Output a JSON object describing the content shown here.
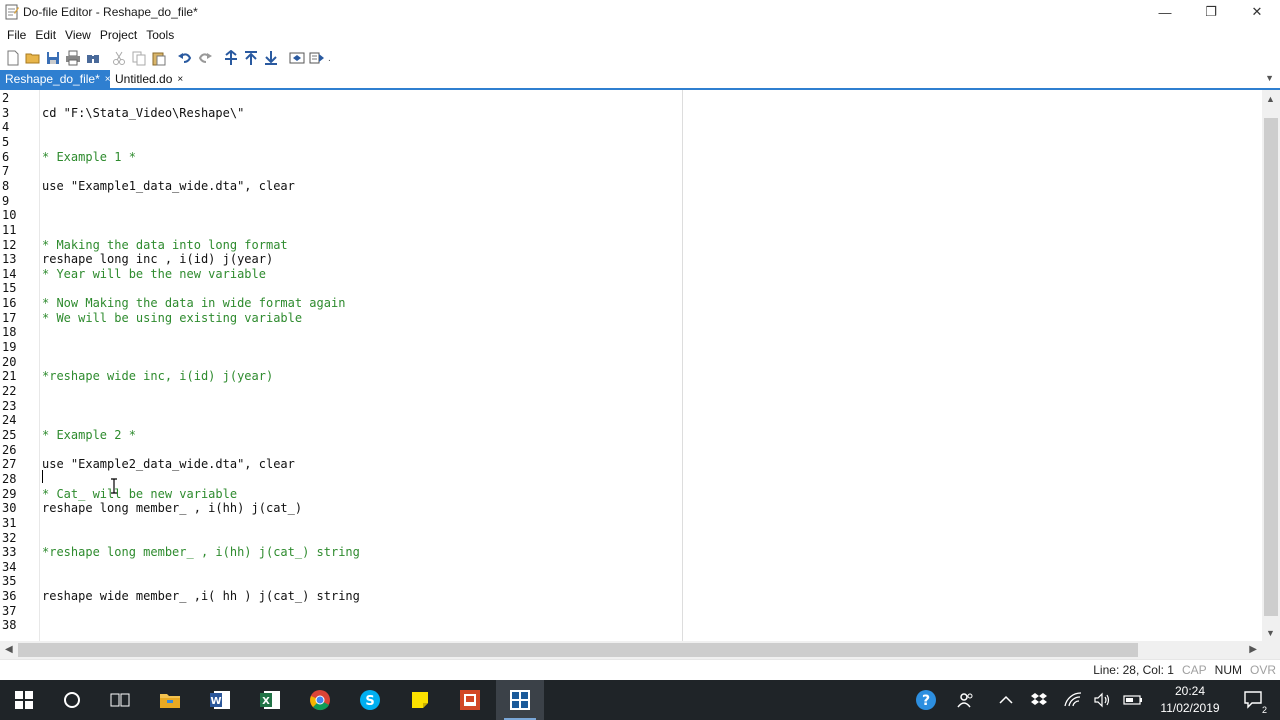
{
  "window": {
    "title": "Do-file Editor - Reshape_do_file*",
    "controls": {
      "minimize": "—",
      "maximize": "❐",
      "close": "✕"
    }
  },
  "menu": [
    "File",
    "Edit",
    "View",
    "Project",
    "Tools"
  ],
  "toolbar_icons": [
    "new-file-icon",
    "open-folder-icon",
    "save-icon",
    "print-icon",
    "find-icon",
    "cut-icon",
    "copy-icon",
    "paste-icon",
    "undo-icon",
    "redo-icon",
    "indent-icon",
    "move-up-icon",
    "move-down-icon",
    "show-hide-icon",
    "execute-icon"
  ],
  "tabs": [
    {
      "label": "Reshape_do_file*",
      "close": "×",
      "active": true
    },
    {
      "label": "Untitled.do",
      "close": "×",
      "active": false
    }
  ],
  "editor": {
    "lines": [
      {
        "n": "2",
        "text": "",
        "type": "code"
      },
      {
        "n": "3",
        "text": "cd \"F:\\Stata_Video\\Reshape\\\"",
        "type": "code"
      },
      {
        "n": "4",
        "text": "",
        "type": "code"
      },
      {
        "n": "5",
        "text": "",
        "type": "code"
      },
      {
        "n": "6",
        "text": "* Example 1 *",
        "type": "comment"
      },
      {
        "n": "7",
        "text": "",
        "type": "code"
      },
      {
        "n": "8",
        "text": "use \"Example1_data_wide.dta\", clear",
        "type": "code"
      },
      {
        "n": "9",
        "text": "",
        "type": "code"
      },
      {
        "n": "10",
        "text": "",
        "type": "code"
      },
      {
        "n": "11",
        "text": "",
        "type": "code"
      },
      {
        "n": "12",
        "text": "* Making the data into long format",
        "type": "comment"
      },
      {
        "n": "13",
        "text": "reshape long inc , i(id) j(year)",
        "type": "code"
      },
      {
        "n": "14",
        "text": "* Year will be the new variable",
        "type": "comment"
      },
      {
        "n": "15",
        "text": "",
        "type": "code"
      },
      {
        "n": "16",
        "text": "* Now Making the data in wide format again",
        "type": "comment"
      },
      {
        "n": "17",
        "text": "* We will be using existing variable",
        "type": "comment"
      },
      {
        "n": "18",
        "text": "",
        "type": "code"
      },
      {
        "n": "19",
        "text": "",
        "type": "code"
      },
      {
        "n": "20",
        "text": "",
        "type": "code"
      },
      {
        "n": "21",
        "text": "*reshape wide inc, i(id) j(year)",
        "type": "comment"
      },
      {
        "n": "22",
        "text": "",
        "type": "code"
      },
      {
        "n": "23",
        "text": "",
        "type": "code"
      },
      {
        "n": "24",
        "text": "",
        "type": "code"
      },
      {
        "n": "25",
        "text": "* Example 2 *",
        "type": "comment"
      },
      {
        "n": "26",
        "text": "",
        "type": "code"
      },
      {
        "n": "27",
        "text": "use \"Example2_data_wide.dta\", clear",
        "type": "code"
      },
      {
        "n": "28",
        "text": "",
        "type": "code"
      },
      {
        "n": "29",
        "text": "* Cat_ will be new variable",
        "type": "comment"
      },
      {
        "n": "30",
        "text": "reshape long member_ , i(hh) j(cat_)",
        "type": "code"
      },
      {
        "n": "31",
        "text": "",
        "type": "code"
      },
      {
        "n": "32",
        "text": "",
        "type": "code"
      },
      {
        "n": "33",
        "text": "*reshape long member_ , i(hh) j(cat_) string",
        "type": "comment"
      },
      {
        "n": "34",
        "text": "",
        "type": "code"
      },
      {
        "n": "35",
        "text": "",
        "type": "code"
      },
      {
        "n": "36",
        "text": "reshape wide member_ ,i( hh ) j(cat_) string",
        "type": "code"
      },
      {
        "n": "37",
        "text": "",
        "type": "code"
      },
      {
        "n": "38",
        "text": "",
        "type": "code"
      }
    ]
  },
  "status": {
    "position": "Line: 28, Col: 1",
    "cap": "CAP",
    "num": "NUM",
    "ovr": "OVR"
  },
  "taskbar": {
    "apps": [
      "windows-start-icon",
      "cortana-icon",
      "task-view-icon",
      "file-explorer-icon",
      "word-icon",
      "excel-icon",
      "chrome-icon",
      "skype-icon",
      "sticky-notes-icon",
      "powerpoint-icon",
      "stata-icon"
    ],
    "time": "20:24",
    "date": "11/02/2019",
    "notifications": "2"
  },
  "colors": {
    "accent": "#2f7fd0",
    "comment": "#2e8b2e",
    "taskbar": "#1f2428"
  }
}
